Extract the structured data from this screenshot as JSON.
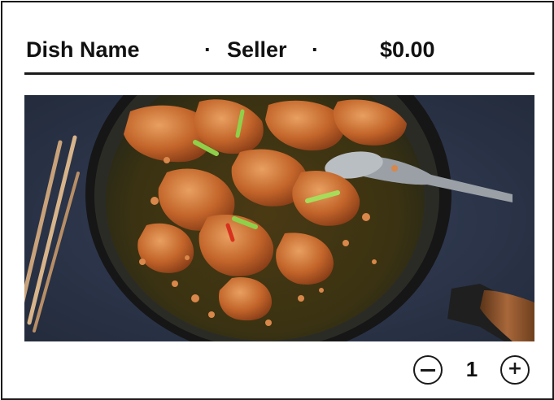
{
  "header": {
    "dish_name": "Dish Name",
    "separator_1": "·",
    "seller": "Seller",
    "separator_2": "·",
    "price": "$0.00"
  },
  "photo": {
    "alt": "Braised chicken pieces with scallions in a black skillet, chopsticks on the side"
  },
  "quantity": {
    "decrement_icon": "minus-circle-icon",
    "value": "1",
    "increment_icon": "plus-circle-icon"
  },
  "colors": {
    "border": "#1a1a1a",
    "background": "#ffffff",
    "table_surface": "#2c3548"
  }
}
